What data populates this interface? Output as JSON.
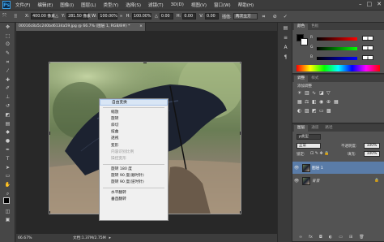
{
  "app": {
    "logo": "Ps"
  },
  "menu": [
    "文件(F)",
    "编辑(E)",
    "图像(I)",
    "图层(L)",
    "类型(Y)",
    "选择(S)",
    "滤镜(T)",
    "3D(D)",
    "视图(V)",
    "窗口(W)",
    "帮助(H)"
  ],
  "window_controls": [
    "–",
    "□",
    "✕"
  ],
  "options": {
    "x_label": "X:",
    "x_value": "400.00 像素",
    "y_label": "Y:",
    "y_value": "281.50 像素",
    "w_label": "W:",
    "w_value": "100.00%",
    "h_label": "H:",
    "h_value": "100.00%",
    "rot_label": "△",
    "rot_value": "0.00",
    "hskew_label": "H:",
    "hskew_value": "0.00",
    "vskew_label": "V:",
    "vskew_value": "0.00",
    "interp_label": "插值:",
    "interp_value": "两次立方"
  },
  "document": {
    "tab_title": "00016c8a5c240bd6134a59.jpg @ 66.7% (图层 1, RGB/8#) *",
    "close": "×"
  },
  "status": {
    "zoom": "66.67%",
    "doc_info": "文档:1.37M/2.75M"
  },
  "context_menu": {
    "items": [
      {
        "label": "自由变换",
        "state": "highlight"
      },
      {
        "sep": true
      },
      {
        "label": "缩放",
        "state": "normal"
      },
      {
        "label": "旋转",
        "state": "normal"
      },
      {
        "label": "斜切",
        "state": "normal"
      },
      {
        "label": "扭曲",
        "state": "normal"
      },
      {
        "label": "透视",
        "state": "normal"
      },
      {
        "label": "变形",
        "state": "normal"
      },
      {
        "label": "内容识别比例",
        "state": "disabled"
      },
      {
        "label": "操控变形",
        "state": "disabled"
      },
      {
        "sep": true
      },
      {
        "label": "旋转 180 度",
        "state": "normal"
      },
      {
        "label": "旋转 90 度(顺时针)",
        "state": "normal"
      },
      {
        "label": "旋转 90 度(逆时针)",
        "state": "normal"
      },
      {
        "sep": true
      },
      {
        "label": "水平翻转",
        "state": "normal"
      },
      {
        "label": "垂直翻转",
        "state": "normal"
      }
    ]
  },
  "color_panel": {
    "tabs": [
      "颜色",
      "色板"
    ],
    "r": "R",
    "g": "G",
    "b": "B",
    "r_val": "0",
    "g_val": "0",
    "b_val": "0"
  },
  "adjust_panel": {
    "tabs": [
      "调整",
      "样式"
    ],
    "hint": "添加调整"
  },
  "layers_panel": {
    "tabs": [
      "图层",
      "通道",
      "路径"
    ],
    "filter": "ρ类型",
    "blend_mode": "正常",
    "opacity_label": "不透明度:",
    "opacity_value": "100%",
    "lock_label": "锁定:",
    "fill_label": "填充:",
    "fill_value": "100%",
    "layers": [
      {
        "name": "图层 1",
        "selected": true
      },
      {
        "name": "背景",
        "selected": false,
        "locked": true
      }
    ]
  },
  "colors": {
    "accent": "#3aa0e6",
    "panel": "#535353",
    "menu_bg": "#f0f0f0",
    "highlight": "#d9e6f5",
    "layer_selected": "#5a7ca8"
  }
}
